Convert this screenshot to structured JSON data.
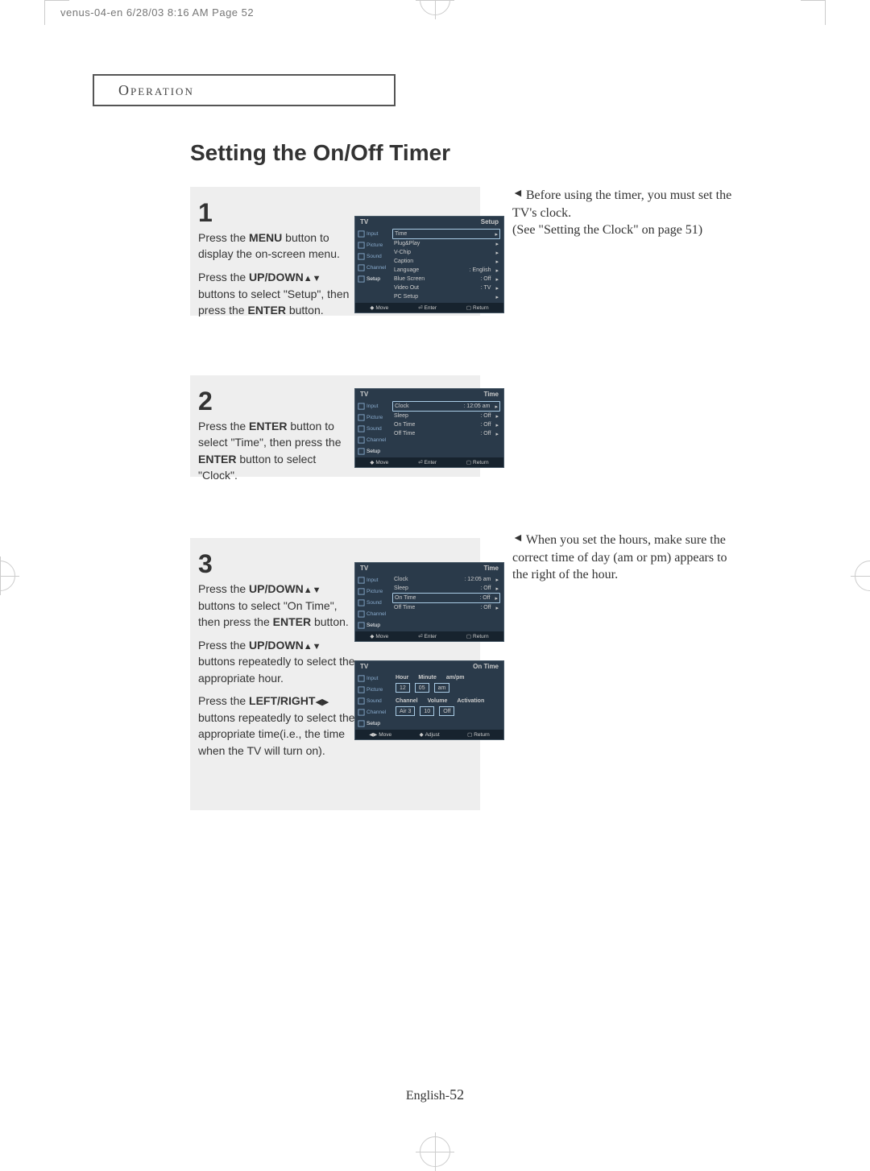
{
  "slug": "venus-04-en  6/28/03  8:16 AM  Page 52",
  "section": "Operation",
  "title": "Setting the On/Off Timer",
  "page_number_prefix": "English-",
  "page_number": "52",
  "notes": {
    "n1a": "Before using the timer, you must set the TV's clock.",
    "n1b": "(See \"Setting the Clock\" on page 51)",
    "n3": "When you set the hours, make sure the correct time of day (am or pm) appears to the right of the hour."
  },
  "steps": {
    "s1": {
      "num": "1",
      "p1a": "Press the ",
      "p1b": "MENU",
      "p1c": " button to display the on-screen menu.",
      "p2a": "Press the ",
      "p2b": "UP/DOWN",
      "p2c": " buttons to select \"Setup\", then press the ",
      "p2d": "ENTER",
      "p2e": " button."
    },
    "s2": {
      "num": "2",
      "p1a": "Press the ",
      "p1b": "ENTER",
      "p1c": " button to select \"Time\", then press the ",
      "p1d": "ENTER",
      "p1e": " button to select \"Clock\"."
    },
    "s3": {
      "num": "3",
      "p1a": "Press the ",
      "p1b": "UP/DOWN",
      "p1c": " buttons to select \"On Time\", then press the ",
      "p1d": "ENTER",
      "p1e": " button.",
      "p2a": "Press the ",
      "p2b": "UP/DOWN",
      "p2c": " buttons repeatedly to select the appropriate hour.",
      "p3a": "Press the ",
      "p3b": "LEFT/RIGHT",
      "p3c": " buttons repeatedly to select the appropriate time(i.e., the time when the TV will turn on)."
    }
  },
  "osd": {
    "side": [
      "Input",
      "Picture",
      "Sound",
      "Channel",
      "Setup"
    ],
    "footer": {
      "move": "Move",
      "enter": "Enter",
      "return": "Return",
      "adjust": "Adjust"
    },
    "screen1": {
      "left": "TV",
      "right": "Setup",
      "rows": [
        {
          "label": "Time",
          "value": "",
          "boxed": true
        },
        {
          "label": "Plug&Play",
          "value": ""
        },
        {
          "label": "V-Chip",
          "value": ""
        },
        {
          "label": "Caption",
          "value": ""
        },
        {
          "label": "Language",
          "value": ": English"
        },
        {
          "label": "Blue Screen",
          "value": ": Off"
        },
        {
          "label": "Video Out",
          "value": ": TV"
        },
        {
          "label": "PC Setup",
          "value": ""
        }
      ]
    },
    "screen2": {
      "left": "TV",
      "right": "Time",
      "rows": [
        {
          "label": "Clock",
          "value": ": 12:05 am",
          "boxed": true
        },
        {
          "label": "Sleep",
          "value": ": Off"
        },
        {
          "label": "On Time",
          "value": ": Off"
        },
        {
          "label": "Off Time",
          "value": ": Off"
        }
      ]
    },
    "screen3a": {
      "left": "TV",
      "right": "Time",
      "rows": [
        {
          "label": "Clock",
          "value": ": 12:05 am"
        },
        {
          "label": "Sleep",
          "value": ": Off"
        },
        {
          "label": "On Time",
          "value": ": Off",
          "boxed": true
        },
        {
          "label": "Off Time",
          "value": ": Off"
        }
      ]
    },
    "screen3b": {
      "left": "TV",
      "right": "On Time",
      "labels1": [
        "Hour",
        "Minute",
        "am/pm"
      ],
      "vals1": [
        "12",
        "05",
        "am"
      ],
      "labels2": [
        "Channel",
        "Volume",
        "Activation"
      ],
      "vals2": [
        "Air 3",
        "10",
        "Off"
      ]
    }
  }
}
